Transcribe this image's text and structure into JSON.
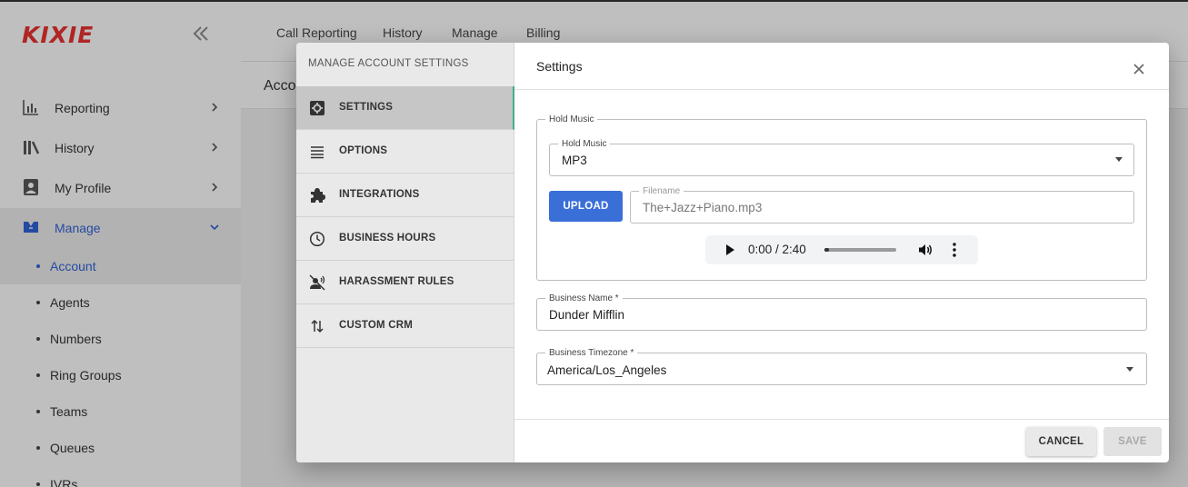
{
  "app": {
    "logo": "KIXIE",
    "brand_color": "#e0312f",
    "accent": "#2f5fd0"
  },
  "sidebar": {
    "items": [
      {
        "label": "Reporting",
        "icon": "bar-chart-icon"
      },
      {
        "label": "History",
        "icon": "library-icon"
      },
      {
        "label": "My Profile",
        "icon": "profile-icon"
      },
      {
        "label": "Manage",
        "icon": "manage-icon",
        "active": true
      }
    ],
    "sub_items": [
      "Account",
      "Agents",
      "Numbers",
      "Ring Groups",
      "Teams",
      "Queues",
      "IVRs"
    ],
    "active_sub": "Account"
  },
  "topbar": {
    "tabs": [
      "Call Reporting",
      "History",
      "Manage",
      "Billing"
    ]
  },
  "subbar": {
    "title": "Account Settings"
  },
  "modal": {
    "nav_title": "MANAGE ACCOUNT SETTINGS",
    "nav_items": [
      {
        "label": "SETTINGS",
        "icon": "settings-icon",
        "active": true
      },
      {
        "label": "OPTIONS",
        "icon": "list-icon"
      },
      {
        "label": "INTEGRATIONS",
        "icon": "puzzle-icon"
      },
      {
        "label": "BUSINESS HOURS",
        "icon": "clock-icon"
      },
      {
        "label": "HARASSMENT RULES",
        "icon": "voice-off-icon"
      },
      {
        "label": "CUSTOM CRM",
        "icon": "swap-vertical-icon"
      }
    ],
    "title": "Settings",
    "hold_music_group": {
      "legend": "Hold Music"
    },
    "hold_music_select": {
      "label": "Hold Music",
      "value": "MP3"
    },
    "upload_button": "UPLOAD",
    "filename_field": {
      "label": "Filename",
      "value": "The+Jazz+Piano.mp3"
    },
    "audio": {
      "time": "0:00 / 2:40",
      "progress": 0.0
    },
    "business_name": {
      "label": "Business Name *",
      "value": "Dunder Mifflin"
    },
    "business_timezone": {
      "label": "Business Timezone *",
      "value": "America/Los_Angeles"
    },
    "cancel_button": "CANCEL",
    "save_button": "SAVE"
  }
}
